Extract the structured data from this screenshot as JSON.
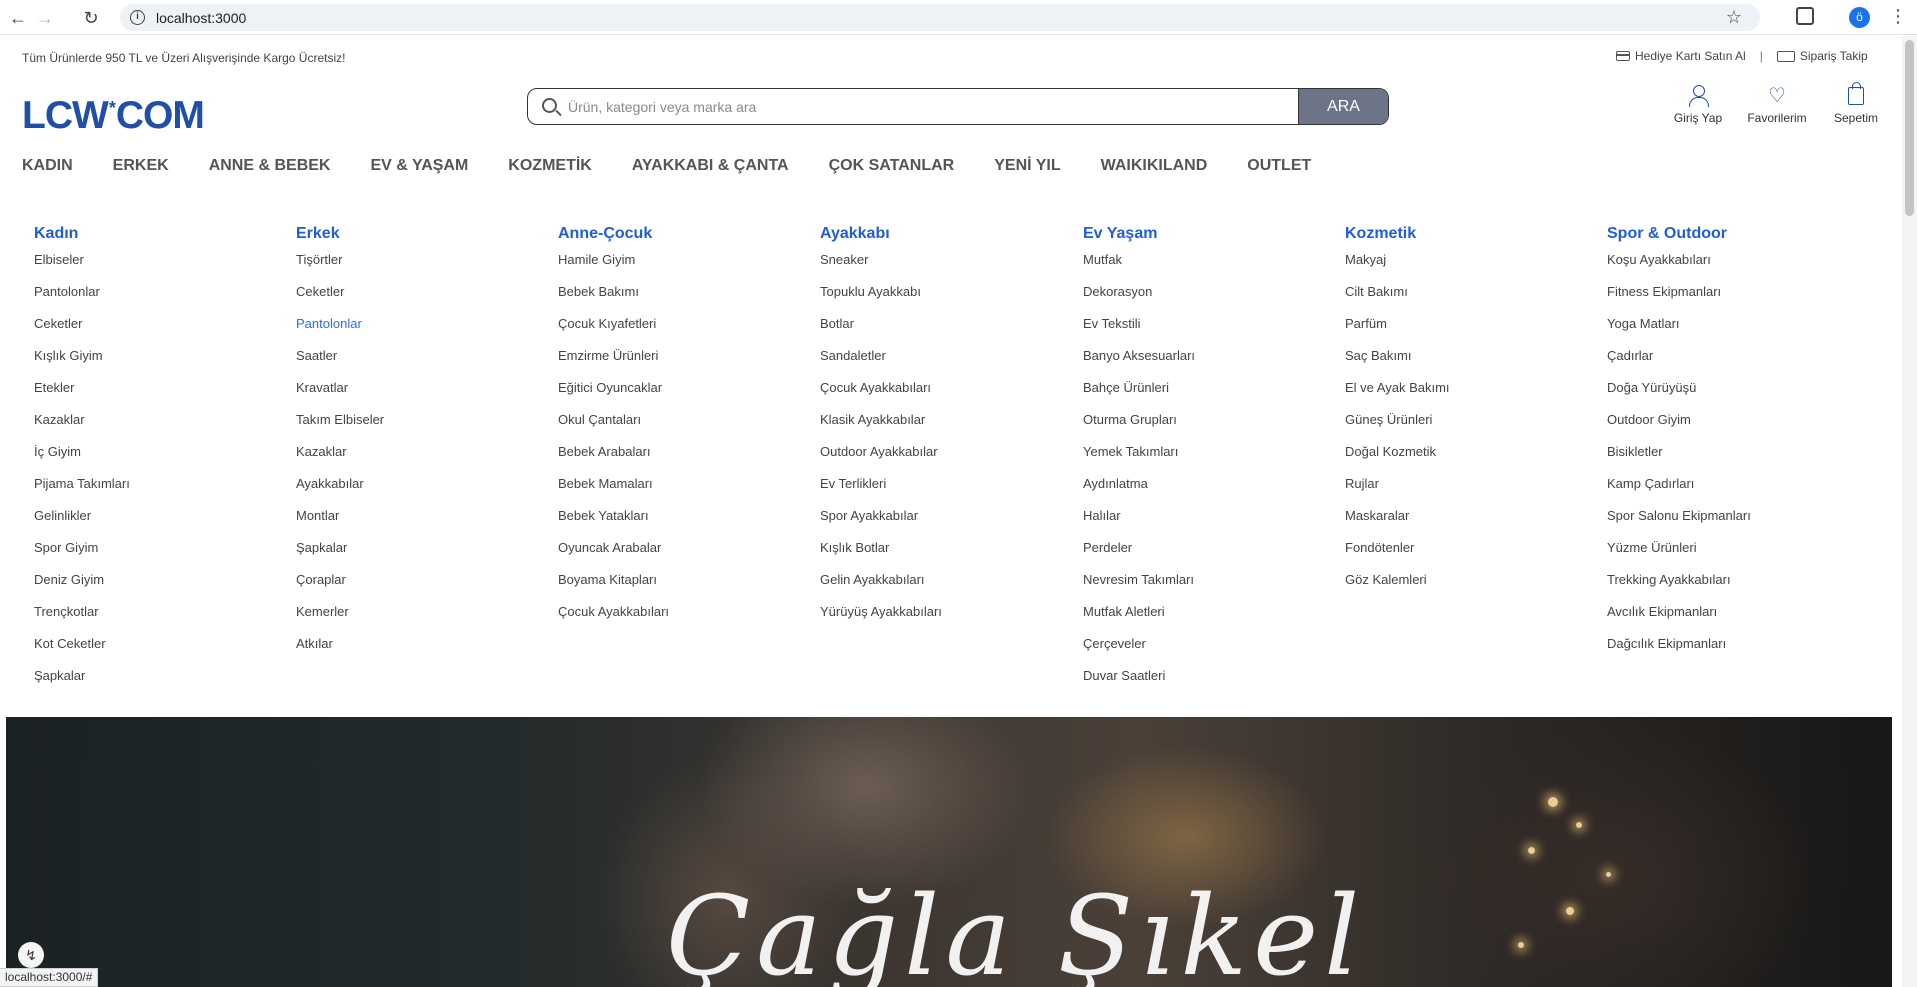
{
  "browser": {
    "url": "localhost:3000",
    "profile_initial": "ö",
    "status_url": "localhost:3000/#"
  },
  "topbar": {
    "promo": "Tüm Ürünlerde 950 TL ve Üzeri Alışverişinde Kargo Ücretsiz!",
    "gift_card": "Hediye Kartı Satın Al",
    "separator": "|",
    "order_track": "Sipariş Takip"
  },
  "header": {
    "logo_left": "LCW",
    "logo_star": "*",
    "logo_right": "COM",
    "search_placeholder": "Ürün, kategori veya marka ara",
    "search_button": "ARA",
    "login": "Giriş Yap",
    "favorites": "Favorilerim",
    "cart": "Sepetim"
  },
  "nav": [
    "KADIN",
    "ERKEK",
    "ANNE & BEBEK",
    "EV & YAŞAM",
    "KOZMETİK",
    "AYAKKABI & ÇANTA",
    "ÇOK SATANLAR",
    "YENİ YIL",
    "WAIKIKILAND",
    "OUTLET"
  ],
  "mega": [
    {
      "title": "Kadın",
      "items": [
        "Elbiseler",
        "Pantolonlar",
        "Ceketler",
        "Kışlık Giyim",
        "Etekler",
        "Kazaklar",
        "İç Giyim",
        "Pijama Takımları",
        "Gelinlikler",
        "Spor Giyim",
        "Deniz Giyim",
        "Trençkotlar",
        "Kot Ceketler",
        "Şapkalar"
      ]
    },
    {
      "title": "Erkek",
      "items": [
        "Tişörtler",
        "Ceketler",
        "Pantolonlar",
        "Saatler",
        "Kravatlar",
        "Takım Elbiseler",
        "Kazaklar",
        "Ayakkabılar",
        "Montlar",
        "Şapkalar",
        "Çoraplar",
        "Kemerler",
        "Atkılar"
      ]
    },
    {
      "title": "Anne-Çocuk",
      "items": [
        "Hamile Giyim",
        "Bebek Bakımı",
        "Çocuk Kıyafetleri",
        "Emzirme Ürünleri",
        "Eğitici Oyuncaklar",
        "Okul Çantaları",
        "Bebek Arabaları",
        "Bebek Mamaları",
        "Bebek Yatakları",
        "Oyuncak Arabalar",
        "Boyama Kitapları",
        "Çocuk Ayakkabıları"
      ]
    },
    {
      "title": "Ayakkabı",
      "items": [
        "Sneaker",
        "Topuklu Ayakkabı",
        "Botlar",
        "Sandaletler",
        "Çocuk Ayakkabıları",
        "Klasik Ayakkabılar",
        "Outdoor Ayakkabılar",
        "Ev Terlikleri",
        "Spor Ayakkabılar",
        "Kışlık Botlar",
        "Gelin Ayakkabıları",
        "Yürüyüş Ayakkabıları"
      ]
    },
    {
      "title": "Ev Yaşam",
      "items": [
        "Mutfak",
        "Dekorasyon",
        "Ev Tekstili",
        "Banyo Aksesuarları",
        "Bahçe Ürünleri",
        "Oturma Grupları",
        "Yemek Takımları",
        "Aydınlatma",
        "Halılar",
        "Perdeler",
        "Nevresim Takımları",
        "Mutfak Aletleri",
        "Çerçeveler",
        "Duvar Saatleri"
      ]
    },
    {
      "title": "Kozmetik",
      "items": [
        "Makyaj",
        "Cilt Bakımı",
        "Parfüm",
        "Saç Bakımı",
        "El ve Ayak Bakımı",
        "Güneş Ürünleri",
        "Doğal Kozmetik",
        "Rujlar",
        "Maskaralar",
        "Fondötenler",
        "Göz Kalemleri"
      ]
    },
    {
      "title": "Spor & Outdoor",
      "items": [
        "Koşu Ayakkabıları",
        "Fitness Ekipmanları",
        "Yoga Matları",
        "Çadırlar",
        "Doğa Yürüyüşü",
        "Outdoor Giyim",
        "Bisikletler",
        "Kamp Çadırları",
        "Spor Salonu Ekipmanları",
        "Yüzme Ürünleri",
        "Trekking Ayakkabıları",
        "Avcılık Ekipmanları",
        "Dağcılık Ekipmanları"
      ]
    }
  ],
  "mega_active": {
    "column": 1,
    "item": 2
  },
  "hero": {
    "script_text": "Çağla Şıkel"
  },
  "colors": {
    "brand": "#1f4fa8",
    "menu_head": "#1f5fd1",
    "search_button": "#6d7487"
  },
  "icons": {
    "gift_card": "credit-card-icon",
    "order_track": "truck-icon",
    "login": "user-icon",
    "favorites": "heart-icon",
    "cart": "shopping-bag-icon"
  }
}
